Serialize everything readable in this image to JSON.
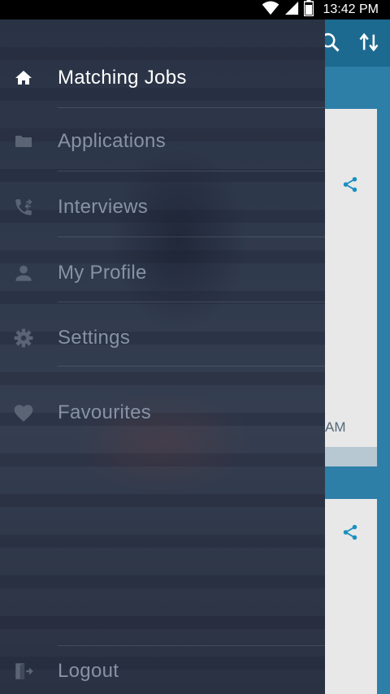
{
  "status_bar": {
    "time": "13:42 PM"
  },
  "drawer": {
    "items": [
      {
        "label": "Matching Jobs",
        "icon": "home-icon",
        "active": true
      },
      {
        "label": "Applications",
        "icon": "folder-icon"
      },
      {
        "label": "Interviews",
        "icon": "phone-forward-icon"
      },
      {
        "label": "My Profile",
        "icon": "person-icon"
      },
      {
        "label": "Settings",
        "icon": "gear-icon"
      },
      {
        "label": "Favourites",
        "icon": "heart-icon"
      }
    ],
    "logout": {
      "label": "Logout",
      "icon": "logout-icon"
    }
  },
  "background": {
    "card_time_fragment": "AM"
  },
  "colors": {
    "accent": "#1a8fc0",
    "app_bar": "#1d6a90"
  }
}
